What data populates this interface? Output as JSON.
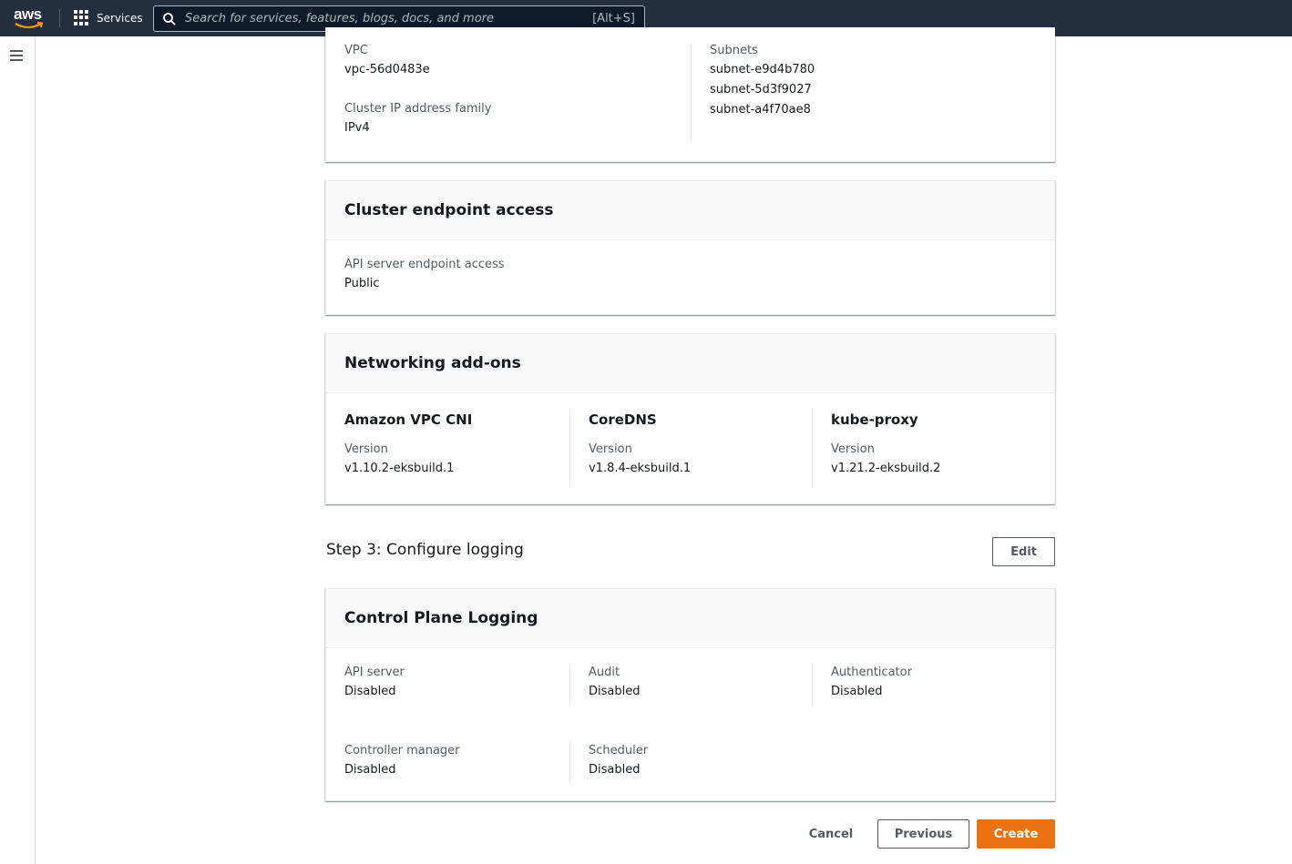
{
  "topnav": {
    "logo_text": "aws",
    "services_label": "Services",
    "search_placeholder": "Search for services, features, blogs, docs, and more",
    "search_shortcut": "[Alt+S]"
  },
  "networking": {
    "vpc_label": "VPC",
    "vpc_value": "vpc-56d0483e",
    "ip_family_label": "Cluster IP address family",
    "ip_family_value": "IPv4",
    "subnets_label": "Subnets",
    "subnets": [
      "subnet-e9d4b780",
      "subnet-5d3f9027",
      "subnet-a4f70ae8"
    ]
  },
  "endpoint_access": {
    "title": "Cluster endpoint access",
    "label": "API server endpoint access",
    "value": "Public"
  },
  "addons": {
    "title": "Networking add-ons",
    "version_label": "Version",
    "items": [
      {
        "name": "Amazon VPC CNI",
        "version": "v1.10.2-eksbuild.1"
      },
      {
        "name": "CoreDNS",
        "version": "v1.8.4-eksbuild.1"
      },
      {
        "name": "kube-proxy",
        "version": "v1.21.2-eksbuild.2"
      }
    ]
  },
  "step3": {
    "title": "Step 3: Configure logging",
    "edit_label": "Edit"
  },
  "logging": {
    "title": "Control Plane Logging",
    "items": [
      {
        "label": "API server",
        "value": "Disabled"
      },
      {
        "label": "Audit",
        "value": "Disabled"
      },
      {
        "label": "Authenticator",
        "value": "Disabled"
      },
      {
        "label": "Controller manager",
        "value": "Disabled"
      },
      {
        "label": "Scheduler",
        "value": "Disabled"
      }
    ]
  },
  "footer": {
    "cancel_label": "Cancel",
    "previous_label": "Previous",
    "create_label": "Create"
  },
  "colors": {
    "nav_bg": "#232f3e",
    "primary": "#ec7211",
    "aws_smile": "#ff9900"
  }
}
